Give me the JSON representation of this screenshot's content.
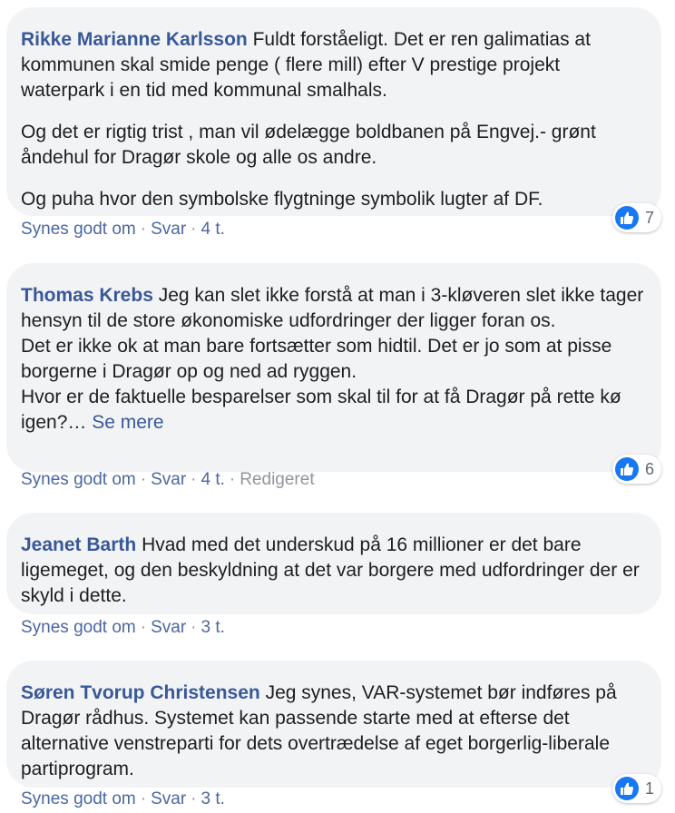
{
  "comments": [
    {
      "author": "Rikke Marianne Karlsson",
      "paragraphs": [
        "Fuldt forståeligt. Det er ren galimatias at kommunen skal smide penge ( flere mill) efter V prestige projekt waterpark i en tid med kommunal smalhals.",
        "Og det er rigtig trist , man vil ødelægge boldbanen på Engvej.- grønt åndehul for Dragør skole og alle os andre.",
        "Og puha hvor den symbolske flygtninge symbolik lugter af DF."
      ],
      "like_label": "Synes godt om",
      "reply_label": "Svar",
      "time": "4 t.",
      "reactions": "7"
    },
    {
      "author": "Thomas Krebs",
      "lines": [
        "Jeg kan slet ikke forstå at man i 3-kløveren slet ikke tager hensyn til de store økonomiske udfordringer der ligger foran os.",
        "Det er ikke ok at man bare fortsætter som hidtil. Det er jo som at pisse borgerne i Dragør op og ned ad ryggen.",
        "Hvor er de faktuelle besparelser som skal til for at få Dragør på rette kø igen?…"
      ],
      "see_more": "Se mere",
      "like_label": "Synes godt om",
      "reply_label": "Svar",
      "time": "4 t.",
      "edited": "Redigeret",
      "reactions": "6"
    },
    {
      "author": "Jeanet Barth",
      "text": "Hvad med det underskud på 16 millioner er det bare ligemeget, og den beskyldning at det var borgere med udfordringer der er skyld i dette.",
      "like_label": "Synes godt om",
      "reply_label": "Svar",
      "time": "3 t."
    },
    {
      "author": "Søren Tvorup Christensen",
      "text": "Jeg synes, VAR-systemet bør indføres på Dragør rådhus. Systemet kan passende starte med at efterse det alternative venstreparti for dets overtrædelse af eget borgerlig-liberale partiprogram.",
      "like_label": "Synes godt om",
      "reply_label": "Svar",
      "time": "3 t.",
      "reactions": "1"
    }
  ],
  "separator": "·",
  "colors": {
    "bubble_bg": "#f2f3f5",
    "author": "#385898",
    "like_blue": "#1877f2",
    "meta_gray": "#90949c"
  },
  "icons": {
    "reaction": "thumbs-up-icon"
  }
}
